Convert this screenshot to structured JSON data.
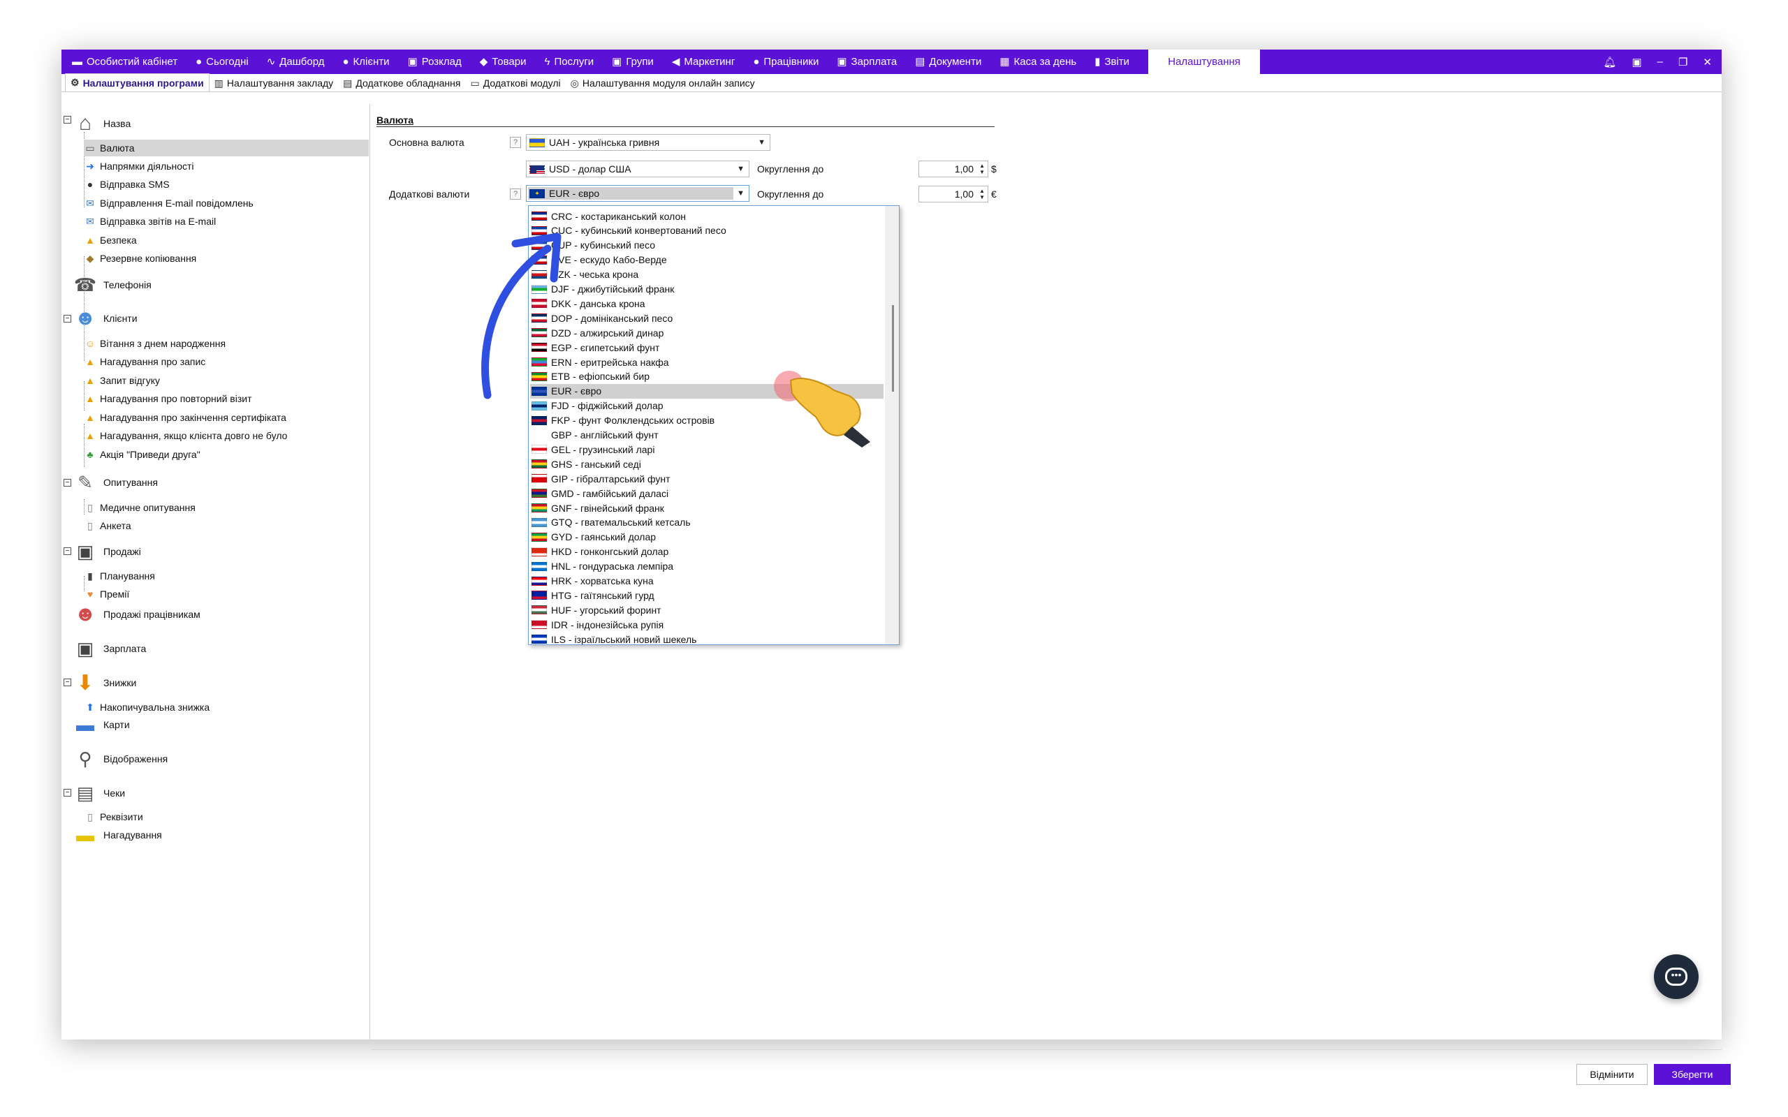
{
  "colors": {
    "brand": "#5c12d6",
    "arrow": "#2f4fe0",
    "selection": "#d6d6d6"
  },
  "topnav": [
    {
      "icon": "wallet-icon",
      "glyph": "▬",
      "label": "Особистий кабінет"
    },
    {
      "icon": "clock-icon",
      "glyph": "●",
      "label": "Сьогодні"
    },
    {
      "icon": "pulse-icon",
      "glyph": "∿",
      "label": "Дашборд"
    },
    {
      "icon": "user-icon",
      "glyph": "●",
      "label": "Клієнти"
    },
    {
      "icon": "calendar-icon",
      "glyph": "▣",
      "label": "Розклад"
    },
    {
      "icon": "box-icon",
      "glyph": "◆",
      "label": "Товари"
    },
    {
      "icon": "lightning-icon",
      "glyph": "ϟ",
      "label": "Послуги"
    },
    {
      "icon": "group-icon",
      "glyph": "▣",
      "label": "Групи"
    },
    {
      "icon": "megaphone-icon",
      "glyph": "◀",
      "label": "Маркетинг"
    },
    {
      "icon": "worker-icon",
      "glyph": "●",
      "label": "Працівники"
    },
    {
      "icon": "money-icon",
      "glyph": "▣",
      "label": "Зарплата"
    },
    {
      "icon": "document-icon",
      "glyph": "▤",
      "label": "Документи"
    },
    {
      "icon": "calculator-icon",
      "glyph": "▦",
      "label": "Каса за день"
    },
    {
      "icon": "bar-chart-icon",
      "glyph": "▮",
      "label": "Звіти"
    }
  ],
  "topnav_active": "Налаштування",
  "subtabs": [
    {
      "icon": "gear-icon",
      "glyph": "⚙",
      "label": "Налаштування програми",
      "active": true
    },
    {
      "icon": "building-icon",
      "glyph": "▥",
      "label": "Налаштування закладу"
    },
    {
      "icon": "printer-icon",
      "glyph": "▤",
      "label": "Додаткове обладнання"
    },
    {
      "icon": "window-icon",
      "glyph": "▭",
      "label": "Додаткові модулі"
    },
    {
      "icon": "globe-icon",
      "glyph": "◎",
      "label": "Налаштування модуля онлайн запису"
    }
  ],
  "sidebar": {
    "home": "Назва",
    "currency": "Валюта",
    "directions": "Напрямки діяльності",
    "sms": "Відправка SMS",
    "email": "Відправлення E-mail повідомлень",
    "email_reports": "Відправка звітів на E-mail",
    "security": "Безпека",
    "backup": "Резервне копіювання",
    "telephony": "Телефонія",
    "clients": "Клієнти",
    "birthday": "Вітання з днем народження",
    "reminder_booking": "Нагадування про запис",
    "feedback": "Запит відгуку",
    "repeat_visit": "Нагадування про повторний візит",
    "certificate": "Нагадування про закінчення сертифіката",
    "long_absent": "Нагадування, якщо клієнта довго не було",
    "referral": "Акція \"Приведи друга\"",
    "surveys": "Опитування",
    "medical": "Медичне опитування",
    "questionnaire": "Анкета",
    "sales": "Продажі",
    "planning": "Планування",
    "bonuses": "Премії",
    "employee_sales": "Продажі працівникам",
    "salary": "Зарплата",
    "discounts": "Знижки",
    "cumulative": "Накопичувальна знижка",
    "cards": "Карти",
    "display": "Відображення",
    "receipts": "Чеки",
    "requisites": "Реквізити",
    "reminders": "Нагадування"
  },
  "content": {
    "section_title": "Валюта",
    "main_currency_label": "Основна валюта",
    "main_currency": "UAH - українська гривня",
    "extra_currency_label": "Додаткові валюти",
    "rounding_label": "Округлення до",
    "row1_currency": "USD - долар США",
    "row1_rounding": "1,00",
    "row1_symbol": "$",
    "row2_currency": "EUR - євро",
    "row2_rounding": "1,00",
    "row2_symbol": "€",
    "help": "?"
  },
  "dropdown": {
    "highlighted": "EUR - євро",
    "options": [
      {
        "label": "CRC - костариканський колон",
        "flag": [
          "#0b2a8a",
          "#fff",
          "#c00"
        ]
      },
      {
        "label": "CUC - кубинський конвертований песо",
        "flag": [
          "#0b3fa8",
          "#fff",
          "#c00"
        ]
      },
      {
        "label": "CUP - кубинський песо",
        "flag": [
          "#0b3fa8",
          "#fff",
          "#c00"
        ]
      },
      {
        "label": "CVE - ескудо Кабо-Верде",
        "flag": [
          "#1a3b8f",
          "#fff",
          "#c00"
        ]
      },
      {
        "label": "CZK - чеська крона",
        "flag": [
          "#fff",
          "#d7141a",
          "#11457e"
        ]
      },
      {
        "label": "DJF - джибутійський франк",
        "flag": [
          "#6ab2e7",
          "#12ad2b",
          "#fff"
        ]
      },
      {
        "label": "DKK - данська крона",
        "flag": [
          "#c8102e",
          "#fff",
          "#c8102e"
        ]
      },
      {
        "label": "DOP - домініканський песо",
        "flag": [
          "#002d62",
          "#fff",
          "#ce1126"
        ]
      },
      {
        "label": "DZD - алжирський динар",
        "flag": [
          "#006233",
          "#fff",
          "#d21034"
        ]
      },
      {
        "label": "EGP - єгипетський фунт",
        "flag": [
          "#ce1126",
          "#fff",
          "#000"
        ]
      },
      {
        "label": "ERN - еритрейська накфа",
        "flag": [
          "#12ad2b",
          "#4189dd",
          "#ea0437"
        ]
      },
      {
        "label": "ETB - ефіопський бир",
        "flag": [
          "#078930",
          "#fcdd09",
          "#da121a"
        ]
      },
      {
        "label": "EUR - євро",
        "flag": [
          "#003399",
          "#3355bb",
          "#003399"
        ]
      },
      {
        "label": "FJD - фіджійський долар",
        "flag": [
          "#68bfe5",
          "#012169",
          "#68bfe5"
        ]
      },
      {
        "label": "FKP - фунт Фолклендських островів",
        "flag": [
          "#012169",
          "#c8102e",
          "#012169"
        ]
      },
      {
        "label": "GBP - англійський фунт",
        "flag": null
      },
      {
        "label": "GEL - грузинський ларі",
        "flag": [
          "#fff",
          "#e30a17",
          "#fff"
        ]
      },
      {
        "label": "GHS - ганський седі",
        "flag": [
          "#ce1126",
          "#fcd116",
          "#006b3f"
        ]
      },
      {
        "label": "GIP - гібралтарський фунт",
        "flag": [
          "#fff",
          "#da000c",
          "#da000c"
        ]
      },
      {
        "label": "GMD - гамбійський даласі",
        "flag": [
          "#ce1126",
          "#0c1c8c",
          "#3a7728"
        ]
      },
      {
        "label": "GNF - гвінейський франк",
        "flag": [
          "#ce1126",
          "#fcd116",
          "#009460"
        ]
      },
      {
        "label": "GTQ - гватемальський кетсаль",
        "flag": [
          "#4997d0",
          "#fff",
          "#4997d0"
        ]
      },
      {
        "label": "GYD - гаянський долар",
        "flag": [
          "#009e49",
          "#fcd116",
          "#ce1126"
        ]
      },
      {
        "label": "HKD - гонконгський долар",
        "flag": [
          "#de2910",
          "#de2910",
          "#fff"
        ]
      },
      {
        "label": "HNL - гондураська лемпіра",
        "flag": [
          "#0073cf",
          "#fff",
          "#0073cf"
        ]
      },
      {
        "label": "HRK - хорватська куна",
        "flag": [
          "#ff0000",
          "#fff",
          "#171796"
        ]
      },
      {
        "label": "HTG - гаїтянський гурд",
        "flag": [
          "#00209f",
          "#00209f",
          "#d21034"
        ]
      },
      {
        "label": "HUF - угорський форинт",
        "flag": [
          "#ce2939",
          "#fff",
          "#477050"
        ]
      },
      {
        "label": "IDR - індонезійська рупія",
        "flag": [
          "#ce1126",
          "#ce1126",
          "#fff"
        ]
      },
      {
        "label": "ILS - ізраїльський новий шекель",
        "flag": [
          "#0038b8",
          "#fff",
          "#0038b8"
        ]
      }
    ]
  },
  "footer": {
    "cancel": "Відмінити",
    "save": "Зберегти"
  }
}
